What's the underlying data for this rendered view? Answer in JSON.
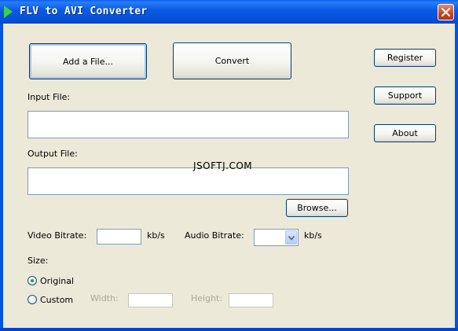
{
  "window": {
    "title": "FLV to AVI Converter"
  },
  "buttons": {
    "add_file": "Add a File...",
    "convert": "Convert",
    "register": "Register",
    "support": "Support",
    "about": "About",
    "browse": "Browse..."
  },
  "fields": {
    "input_file_label": "Input File:",
    "input_file_value": "",
    "output_file_label": "Output File:",
    "output_file_value": "",
    "video_bitrate_label": "Video Bitrate:",
    "video_bitrate_value": "",
    "video_bitrate_unit": "kb/s",
    "audio_bitrate_label": "Audio Bitrate:",
    "audio_bitrate_value": "",
    "audio_bitrate_unit": "kb/s"
  },
  "watermark": "JSOFTJ.COM",
  "size": {
    "label": "Size:",
    "options": [
      {
        "label": "Original",
        "selected": true
      },
      {
        "label": "Custom",
        "selected": false
      }
    ],
    "width_label": "Width:",
    "width_value": "",
    "height_label": "Height:",
    "height_value": ""
  },
  "colors": {
    "titlebar": "#0055e5",
    "client_background": "#ece9d8",
    "button_border": "#003c74",
    "radio_dot": "#21a121",
    "close_button": "#c84521"
  },
  "icons": {
    "app": "green-play-triangle-icon",
    "close": "close-x-icon",
    "combo": "chevron-down-icon"
  }
}
